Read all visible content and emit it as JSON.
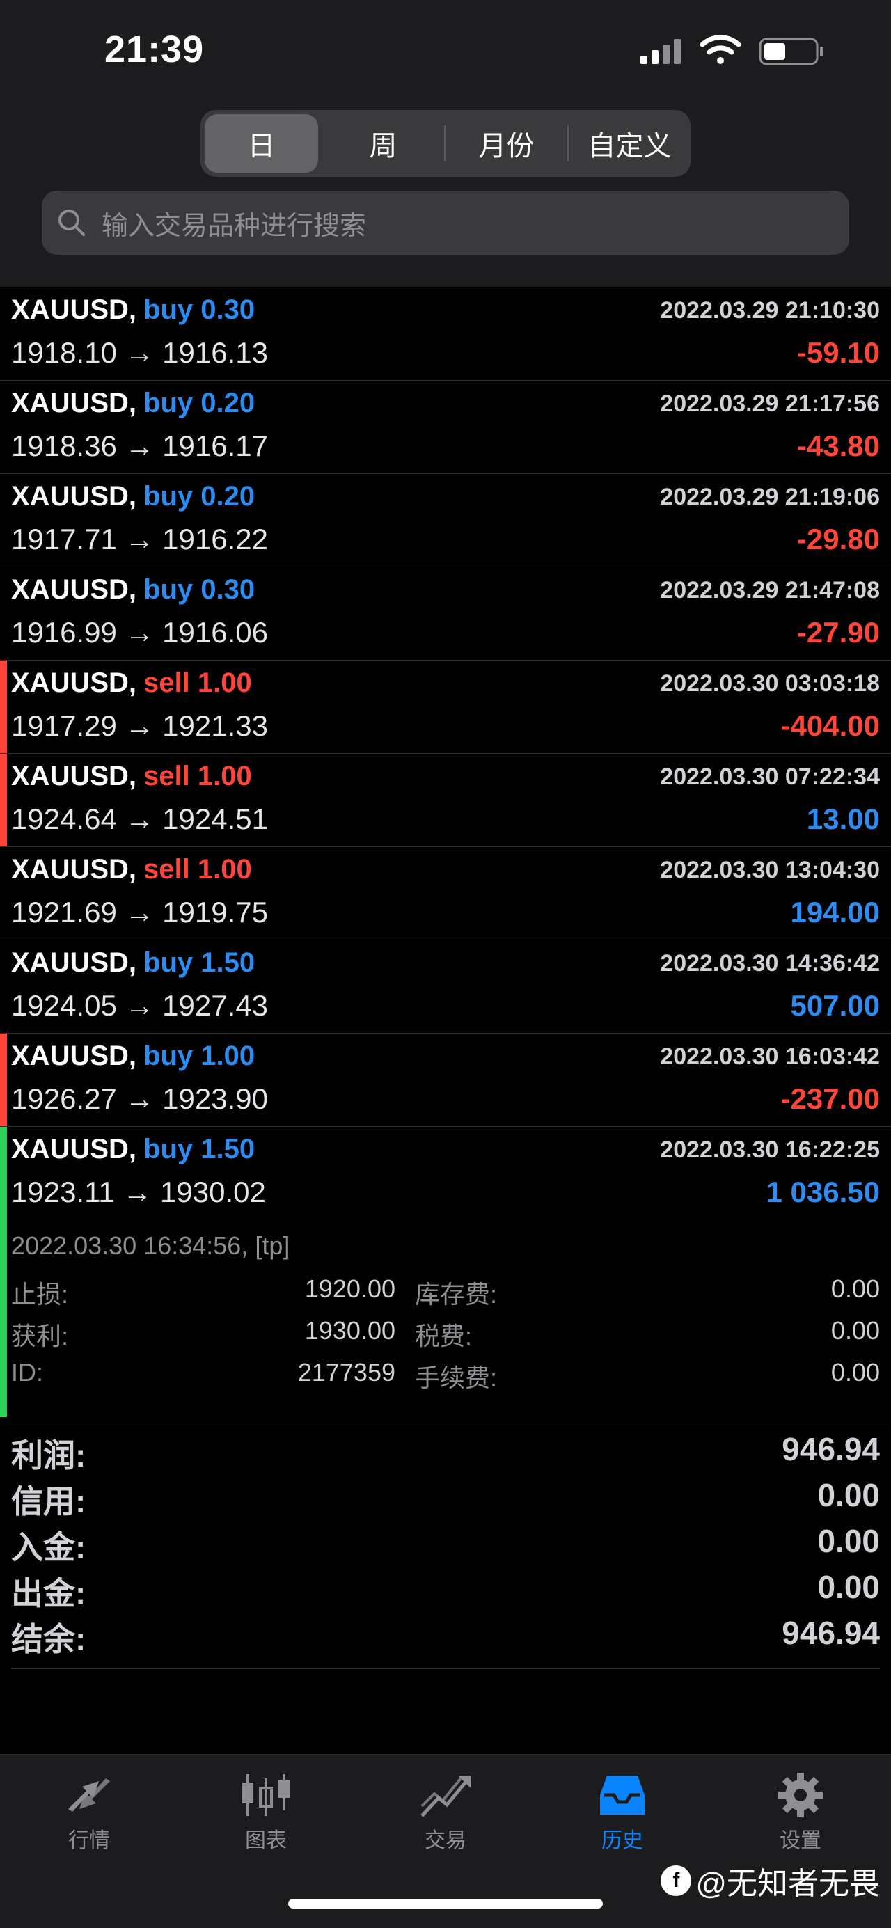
{
  "status": {
    "time": "21:39"
  },
  "period_tabs": [
    "日",
    "周",
    "月份",
    "自定义"
  ],
  "search": {
    "placeholder": "输入交易品种进行搜索"
  },
  "trades": [
    {
      "symbol": "XAUUSD,",
      "side": "buy 0.30",
      "open": "1918.10",
      "close": "1916.13",
      "datetime": "2022.03.29 21:10:30",
      "profit": "-59.10",
      "marker": ""
    },
    {
      "symbol": "XAUUSD,",
      "side": "buy 0.20",
      "open": "1918.36",
      "close": "1916.17",
      "datetime": "2022.03.29 21:17:56",
      "profit": "-43.80",
      "marker": ""
    },
    {
      "symbol": "XAUUSD,",
      "side": "buy 0.20",
      "open": "1917.71",
      "close": "1916.22",
      "datetime": "2022.03.29 21:19:06",
      "profit": "-29.80",
      "marker": ""
    },
    {
      "symbol": "XAUUSD,",
      "side": "buy 0.30",
      "open": "1916.99",
      "close": "1916.06",
      "datetime": "2022.03.29 21:47:08",
      "profit": "-27.90",
      "marker": ""
    },
    {
      "symbol": "XAUUSD,",
      "side": "sell 1.00",
      "open": "1917.29",
      "close": "1921.33",
      "datetime": "2022.03.30 03:03:18",
      "profit": "-404.00",
      "marker": "#ff453a"
    },
    {
      "symbol": "XAUUSD,",
      "side": "sell 1.00",
      "open": "1924.64",
      "close": "1924.51",
      "datetime": "2022.03.30 07:22:34",
      "profit": "13.00",
      "marker": "#ff453a"
    },
    {
      "symbol": "XAUUSD,",
      "side": "sell 1.00",
      "open": "1921.69",
      "close": "1919.75",
      "datetime": "2022.03.30 13:04:30",
      "profit": "194.00",
      "marker": ""
    },
    {
      "symbol": "XAUUSD,",
      "side": "buy 1.50",
      "open": "1924.05",
      "close": "1927.43",
      "datetime": "2022.03.30 14:36:42",
      "profit": "507.00",
      "marker": ""
    },
    {
      "symbol": "XAUUSD,",
      "side": "buy 1.00",
      "open": "1926.27",
      "close": "1923.90",
      "datetime": "2022.03.30 16:03:42",
      "profit": "-237.00",
      "marker": "#ff453a"
    },
    {
      "symbol": "XAUUSD,",
      "side": "buy 1.50",
      "open": "1923.11",
      "close": "1930.02",
      "datetime": "2022.03.30 16:22:25",
      "profit": "1 036.50",
      "marker": "#30d158"
    }
  ],
  "expanded": {
    "close_info": "2022.03.30 16:34:56, [tp]",
    "sl_label": "止损:",
    "sl_value": "1920.00",
    "tp_label": "获利:",
    "tp_value": "1930.00",
    "id_label": "ID:",
    "id_value": "2177359",
    "swap_label": "库存费:",
    "swap_value": "0.00",
    "tax_label": "税费:",
    "tax_value": "0.00",
    "fee_label": "手续费:",
    "fee_value": "0.00"
  },
  "summary": [
    {
      "label": "利润:",
      "value": "946.94"
    },
    {
      "label": "信用:",
      "value": "0.00"
    },
    {
      "label": "入金:",
      "value": "0.00"
    },
    {
      "label": "出金:",
      "value": "0.00"
    },
    {
      "label": "结余:",
      "value": "946.94"
    }
  ],
  "tabbar": [
    {
      "label": "行情",
      "icon": "quotes-icon"
    },
    {
      "label": "图表",
      "icon": "chart-icon"
    },
    {
      "label": "交易",
      "icon": "trade-icon"
    },
    {
      "label": "历史",
      "icon": "history-icon",
      "active": true
    },
    {
      "label": "设置",
      "icon": "settings-icon"
    }
  ],
  "watermark": "@无知者无畏",
  "colors": {
    "buy": "#2d8cf0",
    "sell": "#ff453a",
    "profit_pos": "#2d8cf0",
    "profit_neg": "#ff453a",
    "accent": "#0a84ff"
  }
}
